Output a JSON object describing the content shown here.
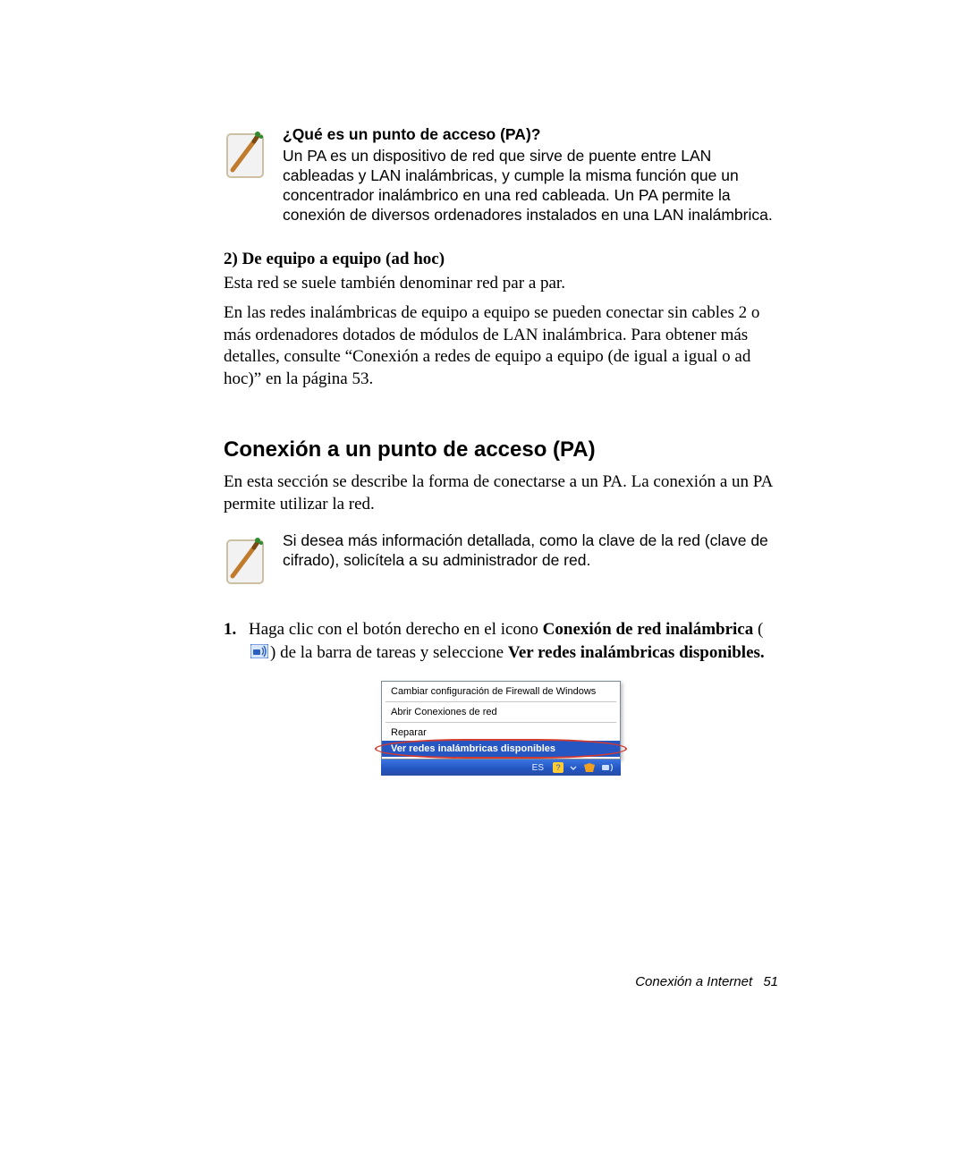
{
  "note1": {
    "title": "¿Qué es un punto de acceso (PA)?",
    "body": "Un PA es un dispositivo de red que sirve de puente entre LAN cableadas y LAN inalámbricas, y cumple la misma función que un concentrador inalámbrico en una red cableada. Un PA permite la conexión de diversos ordenadores instalados en una LAN inalámbrica."
  },
  "adhoc": {
    "heading": "2) De equipo a equipo (ad hoc)",
    "p1": "Esta red se suele también denominar red par a par.",
    "p2": "En las redes inalámbricas de equipo a equipo se pueden conectar sin cables 2 o más ordenadores dotados de módulos de LAN inalámbrica. Para obtener más detalles, consulte “Conexión a redes de equipo a equipo (de igual a igual o ad hoc)” en la página 53."
  },
  "section": {
    "heading": "Conexión a un punto de acceso (PA)",
    "intro": "En esta sección se describe la forma de conectarse a un PA. La conexión a un PA permite utilizar la red."
  },
  "note2": {
    "body": "Si desea más información detallada, como la clave de la red (clave de cifrado), solicítela a su administrador de red."
  },
  "step1": {
    "num": "1.",
    "pre": "Haga clic con el botón derecho en el icono ",
    "bold1": "Conexión de red inalámbrica",
    "mid": " de la barra de tareas y seleccione ",
    "bold2": "Ver redes inalámbricas disponibles."
  },
  "menu": {
    "item1": "Cambiar configuración de Firewall de Windows",
    "item2": "Abrir Conexiones de red",
    "item3": "Reparar",
    "item4": "Ver redes inalámbricas disponibles"
  },
  "taskbar": {
    "lang": "ES"
  },
  "footer": {
    "label": "Conexión a Internet",
    "page": "51"
  }
}
